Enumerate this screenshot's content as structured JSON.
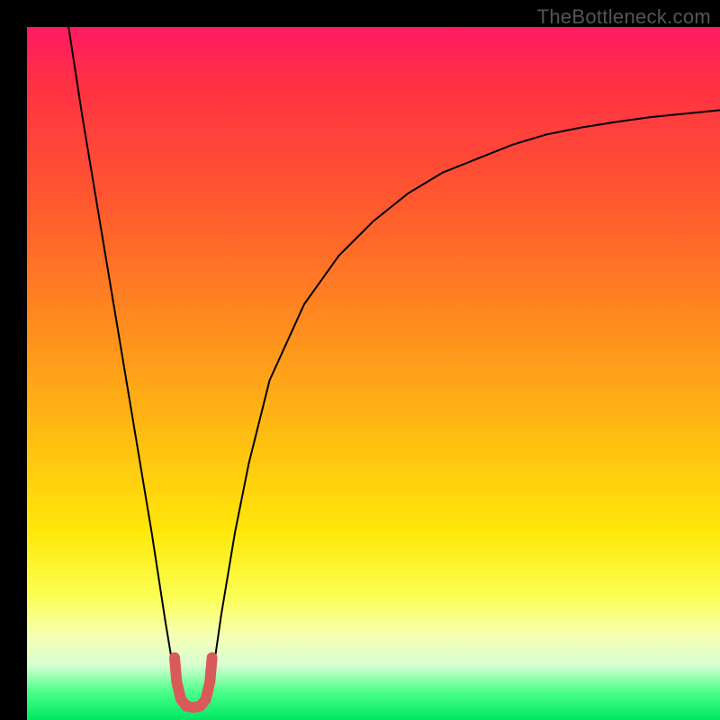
{
  "watermark": "TheBottleneck.com",
  "chart_data": {
    "type": "line",
    "title": "",
    "xlabel": "",
    "ylabel": "",
    "xlim": [
      0,
      100
    ],
    "ylim": [
      0,
      100
    ],
    "background_gradient": {
      "direction": "top-to-bottom",
      "stops": [
        {
          "pos": 0,
          "color": "#ff1a62"
        },
        {
          "pos": 8,
          "color": "#ff3044"
        },
        {
          "pos": 26,
          "color": "#ff5a2e"
        },
        {
          "pos": 44,
          "color": "#ff8f1e"
        },
        {
          "pos": 60,
          "color": "#ffc011"
        },
        {
          "pos": 73,
          "color": "#ffe80a"
        },
        {
          "pos": 82,
          "color": "#fbff52"
        },
        {
          "pos": 88,
          "color": "#f6ffb6"
        },
        {
          "pos": 92,
          "color": "#d8ffd2"
        },
        {
          "pos": 96,
          "color": "#4aff88"
        },
        {
          "pos": 100,
          "color": "#00e763"
        }
      ]
    },
    "series": [
      {
        "name": "bottleneck-curve",
        "stroke": "#000000",
        "stroke_width": 2,
        "x": [
          6,
          8,
          10,
          12,
          14,
          16,
          18,
          20,
          21,
          22,
          23,
          24,
          25,
          26,
          27,
          28,
          30,
          32,
          35,
          40,
          45,
          50,
          55,
          60,
          65,
          70,
          75,
          80,
          85,
          90,
          95,
          100
        ],
        "y": [
          100,
          87,
          75,
          63,
          51,
          39,
          27,
          14,
          8,
          4,
          2,
          2,
          2,
          4,
          8,
          15,
          27,
          37,
          49,
          60,
          67,
          72,
          76,
          79,
          81,
          83,
          84.5,
          85.5,
          86.3,
          87,
          87.5,
          88
        ]
      }
    ],
    "u_marker": {
      "name": "optimal-u-marker",
      "stroke": "#d85a5a",
      "stroke_width": 12,
      "linecap": "round",
      "x": [
        21.3,
        21.6,
        22.2,
        23.0,
        24.0,
        25.0,
        25.8,
        26.4,
        26.7
      ],
      "y": [
        9.0,
        5.5,
        3.0,
        2.0,
        1.8,
        2.0,
        3.0,
        5.5,
        9.0
      ]
    }
  }
}
